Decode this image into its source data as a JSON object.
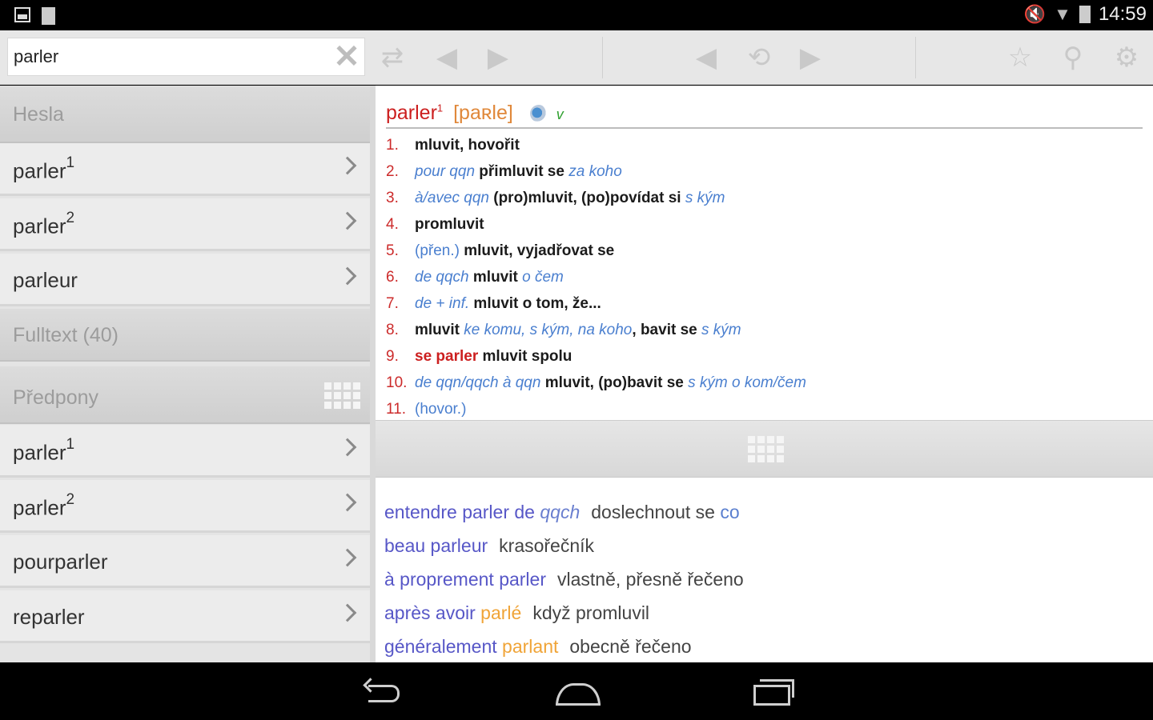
{
  "status_bar": {
    "time": "14:59"
  },
  "search": {
    "value": "parler"
  },
  "left_panel": {
    "sections": {
      "hesla": "Hesla",
      "fulltext": "Fulltext (40)",
      "predpony": "Předpony"
    },
    "hesla_items": [
      {
        "word": "parler",
        "sup": "1"
      },
      {
        "word": "parler",
        "sup": "2"
      },
      {
        "word": "parleur",
        "sup": ""
      }
    ],
    "predpony_items": [
      {
        "word": "parler",
        "sup": "1"
      },
      {
        "word": "parler",
        "sup": "2"
      },
      {
        "word": "pourparler",
        "sup": ""
      },
      {
        "word": "reparler",
        "sup": ""
      }
    ]
  },
  "entry": {
    "headword": "parler",
    "headword_sup": "1",
    "pronunciation": "[paʀle]",
    "pos": "v",
    "senses": [
      {
        "num": "1.",
        "parts": [
          [
            "bl",
            "mluvit, hovořit"
          ]
        ]
      },
      {
        "num": "2.",
        "parts": [
          [
            "it",
            "pour qqn"
          ],
          [
            "sp",
            " "
          ],
          [
            "bl",
            "přimluvit se"
          ],
          [
            "sp",
            " "
          ],
          [
            "it",
            "za koho"
          ]
        ]
      },
      {
        "num": "3.",
        "parts": [
          [
            "it",
            "à/avec qqn"
          ],
          [
            "sp",
            " "
          ],
          [
            "bl",
            "(pro)mluvit, (po)povídat si"
          ],
          [
            "sp",
            " "
          ],
          [
            "it",
            "s kým"
          ]
        ]
      },
      {
        "num": "4.",
        "parts": [
          [
            "bl",
            "promluvit"
          ]
        ]
      },
      {
        "num": "5.",
        "parts": [
          [
            "gr",
            "(přen.)"
          ],
          [
            "sp",
            " "
          ],
          [
            "bl",
            "mluvit, vyjadřovat se"
          ]
        ]
      },
      {
        "num": "6.",
        "parts": [
          [
            "it",
            "de qqch"
          ],
          [
            "sp",
            " "
          ],
          [
            "bl",
            "mluvit"
          ],
          [
            "sp",
            " "
          ],
          [
            "it",
            "o čem"
          ]
        ]
      },
      {
        "num": "7.",
        "parts": [
          [
            "it",
            "de + inf."
          ],
          [
            "sp",
            " "
          ],
          [
            "bl",
            "mluvit o tom, že..."
          ]
        ]
      },
      {
        "num": "8.",
        "parts": [
          [
            "bl",
            "mluvit"
          ],
          [
            "sp",
            " "
          ],
          [
            "it",
            "ke komu, s kým, na koho"
          ],
          [
            "bl",
            ", bavit se"
          ],
          [
            "sp",
            " "
          ],
          [
            "it",
            "s kým"
          ]
        ]
      },
      {
        "num": "9.",
        "parts": [
          [
            "rd",
            "se parler"
          ],
          [
            "sp",
            " "
          ],
          [
            "bl",
            "mluvit spolu"
          ]
        ]
      },
      {
        "num": "10.",
        "parts": [
          [
            "it",
            "de qqn/qqch à qqn"
          ],
          [
            "sp",
            " "
          ],
          [
            "bl",
            "mluvit, (po)bavit se"
          ],
          [
            "sp",
            " "
          ],
          [
            "it",
            "s kým o kom/čem"
          ]
        ]
      },
      {
        "num": "11.",
        "parts": [
          [
            "gr",
            "(hovor.)"
          ]
        ]
      }
    ]
  },
  "phrases": [
    {
      "fr": [
        [
          "fr",
          "entendre parler de "
        ],
        [
          "it",
          "qqch"
        ]
      ],
      "cz": [
        [
          "cz",
          "doslechnout se "
        ],
        [
          "czi",
          "co"
        ]
      ]
    },
    {
      "fr": [
        [
          "fr",
          "beau parleur"
        ]
      ],
      "cz": [
        [
          "cz",
          "krasořečník"
        ]
      ]
    },
    {
      "fr": [
        [
          "fr",
          "à proprement parler"
        ]
      ],
      "cz": [
        [
          "cz",
          "vlastně, přesně řečeno"
        ]
      ]
    },
    {
      "fr": [
        [
          "fr",
          "après avoir "
        ],
        [
          "or",
          "parlé"
        ]
      ],
      "cz": [
        [
          "cz",
          "když promluvil"
        ]
      ]
    },
    {
      "fr": [
        [
          "fr",
          "généralement "
        ],
        [
          "or",
          "parlant"
        ]
      ],
      "cz": [
        [
          "cz",
          "obecně řečeno"
        ]
      ]
    }
  ],
  "colors": {
    "headword": "#cc1f1f",
    "pronunciation": "#e0883a",
    "pos": "#2fa02f",
    "italic_blue": "#4a7fcf",
    "phrase_fr": "#5757c7",
    "phrase_highlight": "#f0a437"
  },
  "icons": {
    "toolbar": [
      "clear-icon",
      "swap-icon",
      "prev-icon",
      "next-icon",
      "history-back-icon",
      "history-icon",
      "history-forward-icon",
      "star-icon",
      "search-key-icon",
      "settings-gear-icon"
    ]
  }
}
